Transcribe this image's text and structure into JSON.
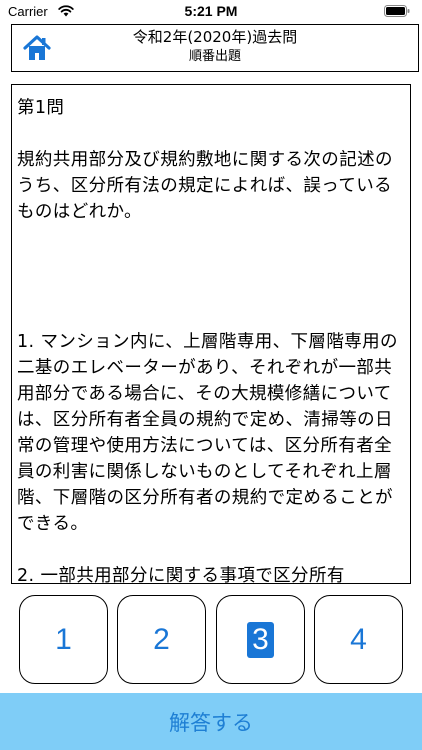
{
  "status_bar": {
    "carrier": "Carrier",
    "time": "5:21 PM",
    "icons": [
      "wifi-icon",
      "battery-icon"
    ]
  },
  "header": {
    "title": "令和2年(2020年)過去問",
    "subtitle": "順番出題",
    "home_icon": "home-icon",
    "accent_color": "#1976d6"
  },
  "question": {
    "number": "第1問",
    "text": "規約共用部分及び規約敷地に関する次の記述のうち、区分所有法の規定によれば、誤っているものはどれか。",
    "options": [
      "1. マンション内に、上層階専用、下層階専用の二基のエレベーターがあり、それぞれが一部共用部分である場合に、その大規模修繕については、区分所有者全員の規約で定め、清掃等の日常の管理や使用方法については、区分所有者全員の利害に関係しないものとしてそれぞれ上層階、下層階の区分所有者の規約で定めることができる。",
      "2. 一部共用部分に関する事項で区分所有"
    ]
  },
  "answers": {
    "buttons": [
      "1",
      "2",
      "3",
      "4"
    ],
    "selected": "3",
    "selected_color": "#1976d6"
  },
  "submit": {
    "label": "解答する",
    "background": "#7fcdf7"
  }
}
